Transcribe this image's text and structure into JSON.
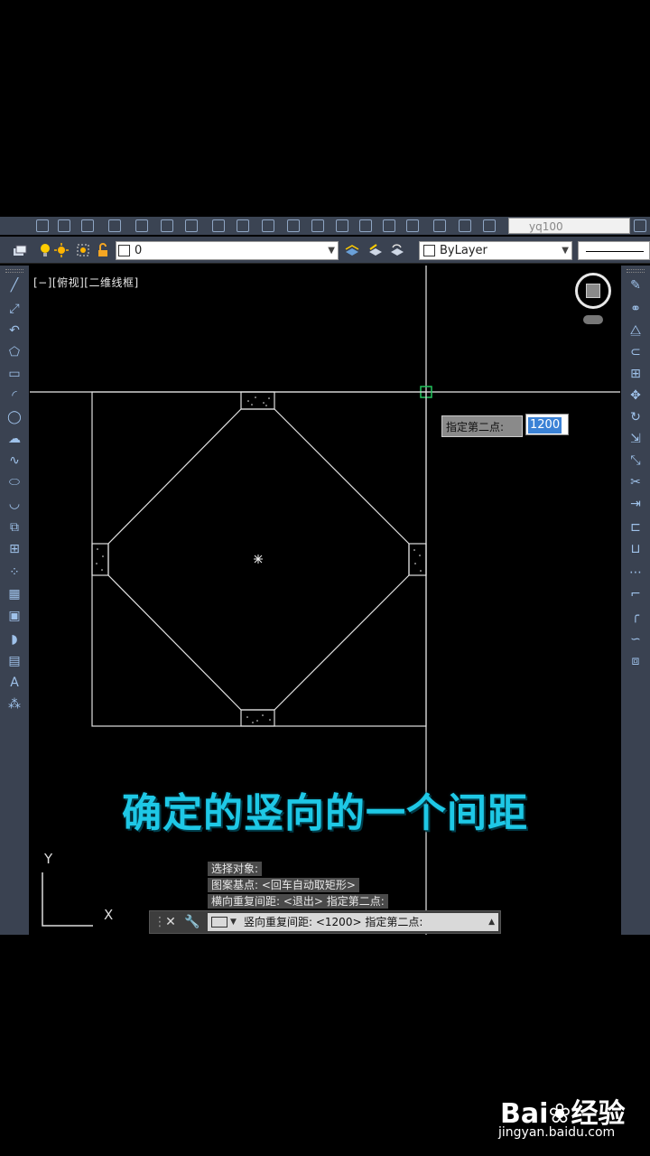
{
  "toolbar": {
    "workspace_value": "yq100"
  },
  "layer_bar": {
    "layer_name": "0",
    "color_value": "ByLayer"
  },
  "viewport": {
    "label": "[−][俯视][二维线框]"
  },
  "dynamic_input": {
    "prompt": "指定第二点:",
    "value": "1200"
  },
  "subtitle": "确定的竖向的一个间距",
  "ucs": {
    "y_label": "Y",
    "x_label": "X"
  },
  "command": {
    "history": [
      "选择对象:",
      "图案基点: <回车自动取矩形>",
      "横向重复间距: <退出>  指定第二点:"
    ],
    "current": "竖向重复间距: <1200>  指定第二点:"
  },
  "watermark": {
    "logo": "Bai❀经验",
    "url": "jingyan.baidu.com"
  },
  "colors": {
    "toolbar_bg": "#3a4251",
    "subtitle": "#1ec8e6",
    "snap_marker": "#22c55e",
    "dyn_highlight": "#3b82d6"
  }
}
